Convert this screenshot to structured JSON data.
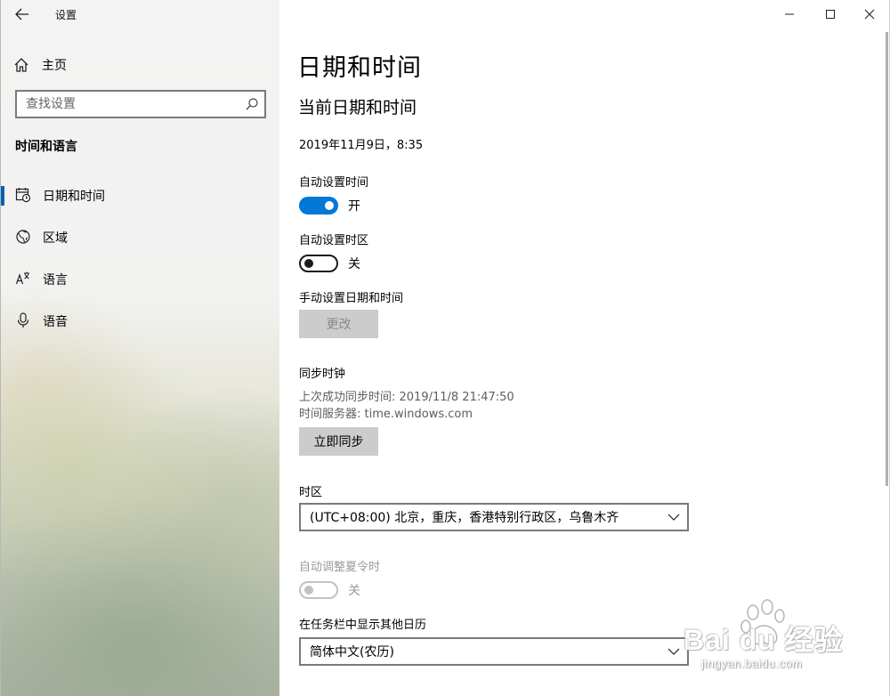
{
  "window": {
    "title": "设置",
    "controls": [
      "minimize",
      "maximize",
      "close"
    ]
  },
  "sidebar": {
    "home_label": "主页",
    "search_placeholder": "查找设置",
    "section_title": "时间和语言",
    "items": [
      {
        "label": "日期和时间",
        "icon": "calendar-clock-icon",
        "active": true
      },
      {
        "label": "区域",
        "icon": "globe-icon",
        "active": false
      },
      {
        "label": "语言",
        "icon": "language-icon",
        "active": false
      },
      {
        "label": "语音",
        "icon": "microphone-icon",
        "active": false
      }
    ]
  },
  "main": {
    "page_title": "日期和时间",
    "current_section": "当前日期和时间",
    "current_datetime": "2019年11月9日，8:35",
    "auto_time": {
      "label": "自动设置时间",
      "state": "开",
      "on": true
    },
    "auto_timezone": {
      "label": "自动设置时区",
      "state": "关",
      "on": false
    },
    "manual": {
      "label": "手动设置日期和时间",
      "button": "更改"
    },
    "sync": {
      "title": "同步时钟",
      "last_sync": "上次成功同步时间: 2019/11/8 21:47:50",
      "server": "时间服务器: time.windows.com",
      "button": "立即同步"
    },
    "timezone": {
      "label": "时区",
      "value": "(UTC+08:00) 北京，重庆，香港特别行政区，乌鲁木齐"
    },
    "dst": {
      "label": "自动调整夏令时",
      "state": "关",
      "enabled": false
    },
    "calendar": {
      "label": "在任务栏中显示其他日历",
      "value": "简体中文(农历)"
    }
  },
  "watermark": {
    "main": "Bai du 经验",
    "sub": "jingyan.baidu.com"
  },
  "colors": {
    "accent": "#0078d7",
    "active_indicator": "#0063b1",
    "button_bg": "#cccccc"
  }
}
